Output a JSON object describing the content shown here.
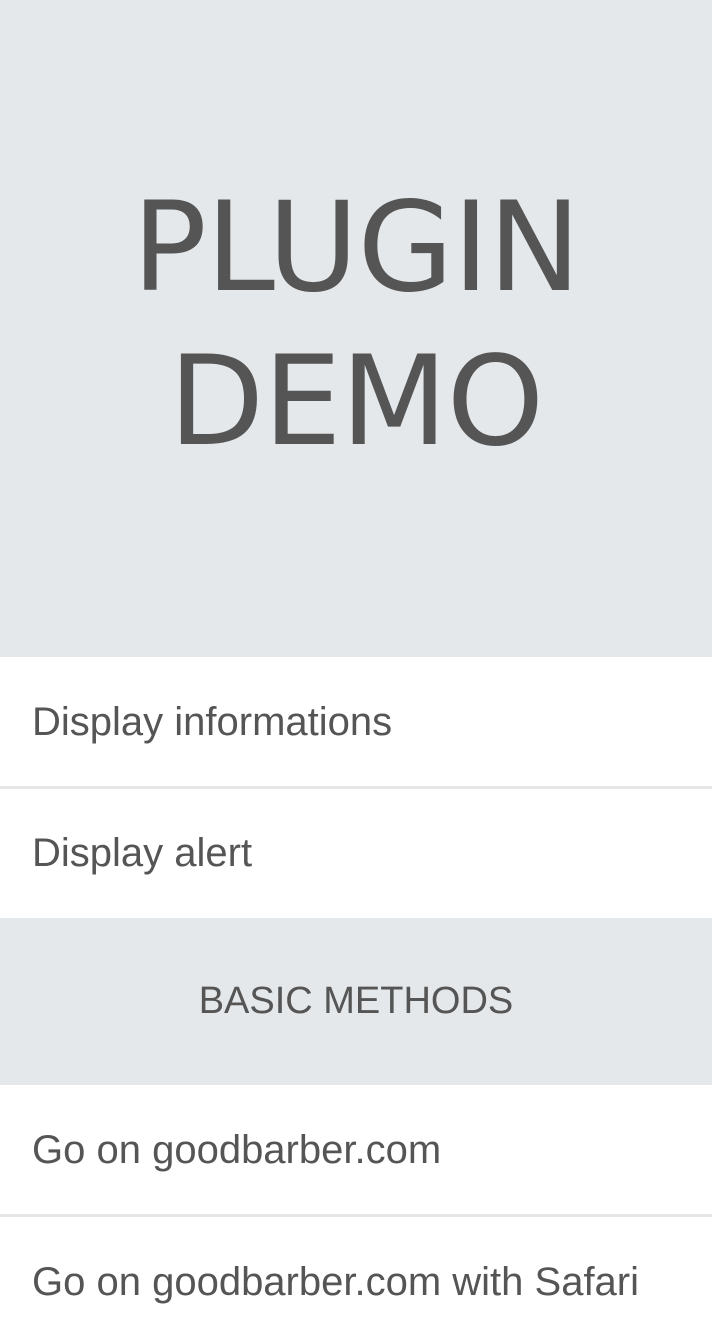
{
  "hero": {
    "title": "PLUGIN DEMO"
  },
  "list_top": [
    {
      "label": "Display informations"
    },
    {
      "label": "Display alert"
    }
  ],
  "section": {
    "title": "BASIC METHODS"
  },
  "list_bottom": [
    {
      "label": "Go on goodbarber.com"
    },
    {
      "label": "Go on goodbarber.com with Safari"
    }
  ]
}
